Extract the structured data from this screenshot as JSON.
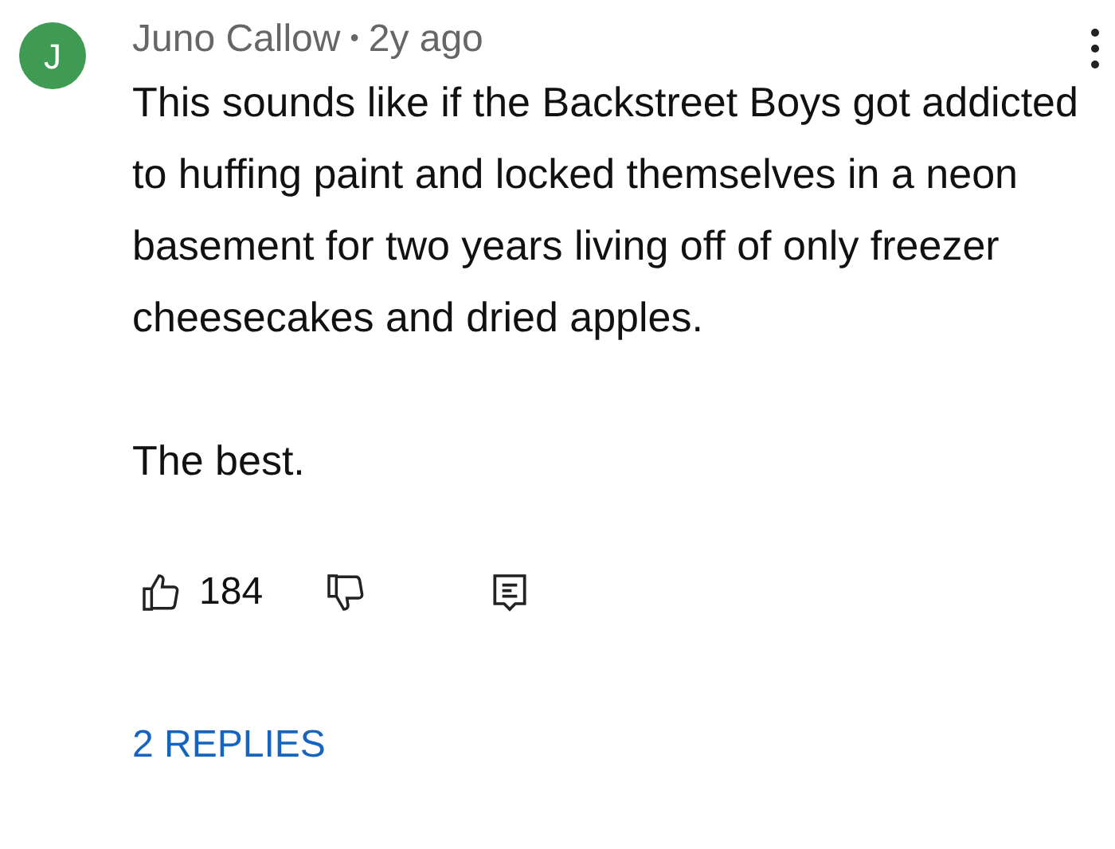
{
  "comment": {
    "avatar_letter": "J",
    "author": "Juno Callow",
    "separator": "•",
    "time": "2y ago",
    "paragraphs": [
      "This sounds like if the Backstreet Boys got addicted to huffing paint and locked themselves in a neon basement for two years living off of only freezer cheesecakes and dried apples.",
      "The best."
    ],
    "likes": "184",
    "replies_link": "2 REPLIES"
  }
}
